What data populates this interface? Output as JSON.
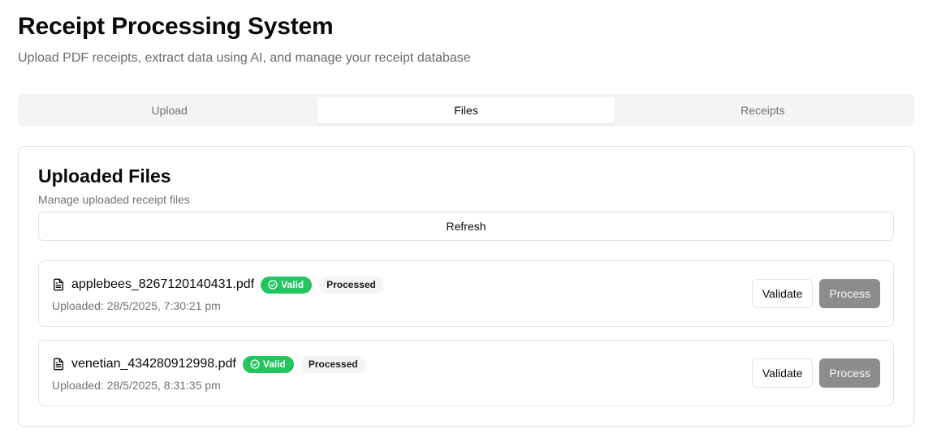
{
  "header": {
    "title": "Receipt Processing System",
    "subtitle": "Upload PDF receipts, extract data using AI, and manage your receipt database"
  },
  "tabs": [
    {
      "label": "Upload",
      "active": false
    },
    {
      "label": "Files",
      "active": true
    },
    {
      "label": "Receipts",
      "active": false
    }
  ],
  "card": {
    "title": "Uploaded Files",
    "description": "Manage uploaded receipt files",
    "refresh_label": "Refresh"
  },
  "files": [
    {
      "name": "applebees_8267120140431.pdf",
      "valid_badge": "Valid",
      "status_badge": "Processed",
      "uploaded": "Uploaded: 28/5/2025, 7:30:21 pm",
      "validate_label": "Validate",
      "process_label": "Process"
    },
    {
      "name": "venetian_434280912998.pdf",
      "valid_badge": "Valid",
      "status_badge": "Processed",
      "uploaded": "Uploaded: 28/5/2025, 8:31:35 pm",
      "validate_label": "Validate",
      "process_label": "Process"
    }
  ],
  "icons": {
    "file": "file-text-icon",
    "valid": "check-circle-icon"
  },
  "colors": {
    "valid_badge": "#22c55e",
    "process_button": "#8c8c8c",
    "tabs_background": "#f4f4f5"
  }
}
